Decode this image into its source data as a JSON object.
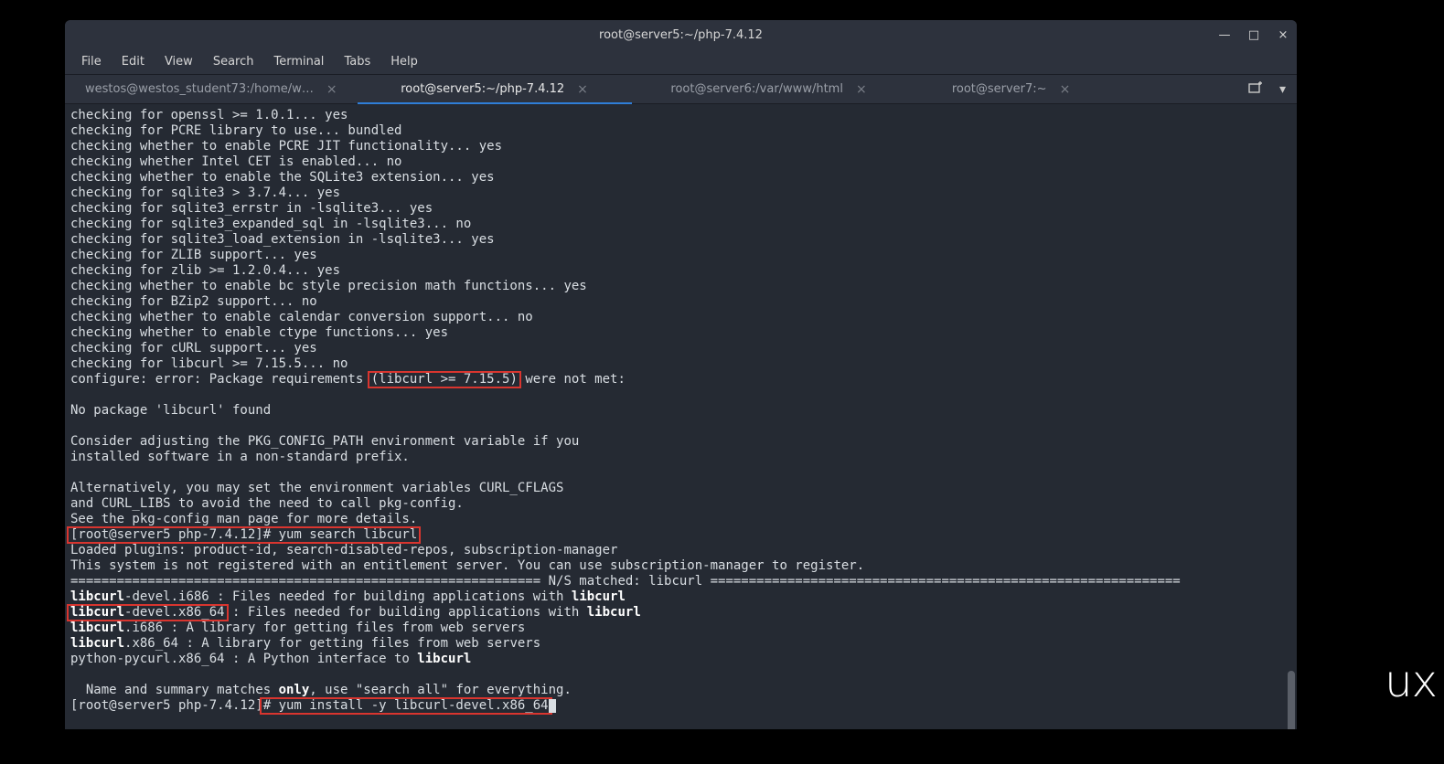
{
  "bg_watermark": "ux",
  "window": {
    "title": "root@server5:~/php-7.4.12",
    "controls": {
      "min": "—",
      "max": "□",
      "close": "×"
    }
  },
  "menu": [
    "File",
    "Edit",
    "View",
    "Search",
    "Terminal",
    "Tabs",
    "Help"
  ],
  "tabs": [
    {
      "label": "westos@westos_student73:/home/w…",
      "active": false
    },
    {
      "label": "root@server5:~/php-7.4.12",
      "active": true
    },
    {
      "label": "root@server6:/var/www/html",
      "active": false
    },
    {
      "label": "root@server7:~",
      "active": false
    }
  ],
  "terminal": {
    "lines_pre1": "checking for openssl >= 1.0.1... yes\nchecking for PCRE library to use... bundled\nchecking whether to enable PCRE JIT functionality... yes\nchecking whether Intel CET is enabled... no\nchecking whether to enable the SQLite3 extension... yes\nchecking for sqlite3 > 3.7.4... yes\nchecking for sqlite3_errstr in -lsqlite3... yes\nchecking for sqlite3_expanded_sql in -lsqlite3... no\nchecking for sqlite3_load_extension in -lsqlite3... yes\nchecking for ZLIB support... yes\nchecking for zlib >= 1.2.0.4... yes\nchecking whether to enable bc style precision math functions... yes\nchecking for BZip2 support... no\nchecking whether to enable calendar conversion support... no\nchecking whether to enable ctype functions... yes\nchecking for cURL support... yes\nchecking for libcurl >= 7.15.5... no",
    "err_pre": "configure: error: Package requirements ",
    "err_hl": "(libcurl >= 7.15.5)",
    "err_post": " were not met:",
    "lines_mid": "\nNo package 'libcurl' found\n\nConsider adjusting the PKG_CONFIG_PATH environment variable if you\ninstalled software in a non-standard prefix.\n\nAlternatively, you may set the environment variables CURL_CFLAGS\nand CURL_LIBS to avoid the need to call pkg-config.\nSee the pkg-config man page for more details.",
    "prompt1": "[root@server5 php-7.4.12]# yum search libcurl",
    "after_prompt1": "Loaded plugins: product-id, search-disabled-repos, subscription-manager\nThis system is not registered with an entitlement server. You can use subscription-manager to register.\n============================================================= N/S matched: libcurl =============================================================",
    "pkg1_a": "libcurl",
    "pkg1_b": "-devel.i686 : Files needed for building applications with ",
    "pkg1_c": "libcurl",
    "pkg2_a": "libcurl",
    "pkg2_b": "-devel.x86_64",
    "pkg2_c": " : Files needed for building applications with ",
    "pkg2_d": "libcurl",
    "pkg3_a": "libcurl",
    "pkg3_b": ".i686 : A library for getting files from web servers",
    "pkg4_a": "libcurl",
    "pkg4_b": ".x86_64 : A library for getting files from web servers",
    "pkg5_a": "python-pycurl.x86_64 : A Python interface to ",
    "pkg5_b": "libcurl",
    "footer_a": "  Name and summary matches ",
    "footer_b": "only",
    "footer_c": ", use \"search all\" for everything.",
    "prompt2_a": "[root@server5 php-7.4.12]",
    "prompt2_b": "# yum install -y libcurl-devel.x86_64"
  }
}
